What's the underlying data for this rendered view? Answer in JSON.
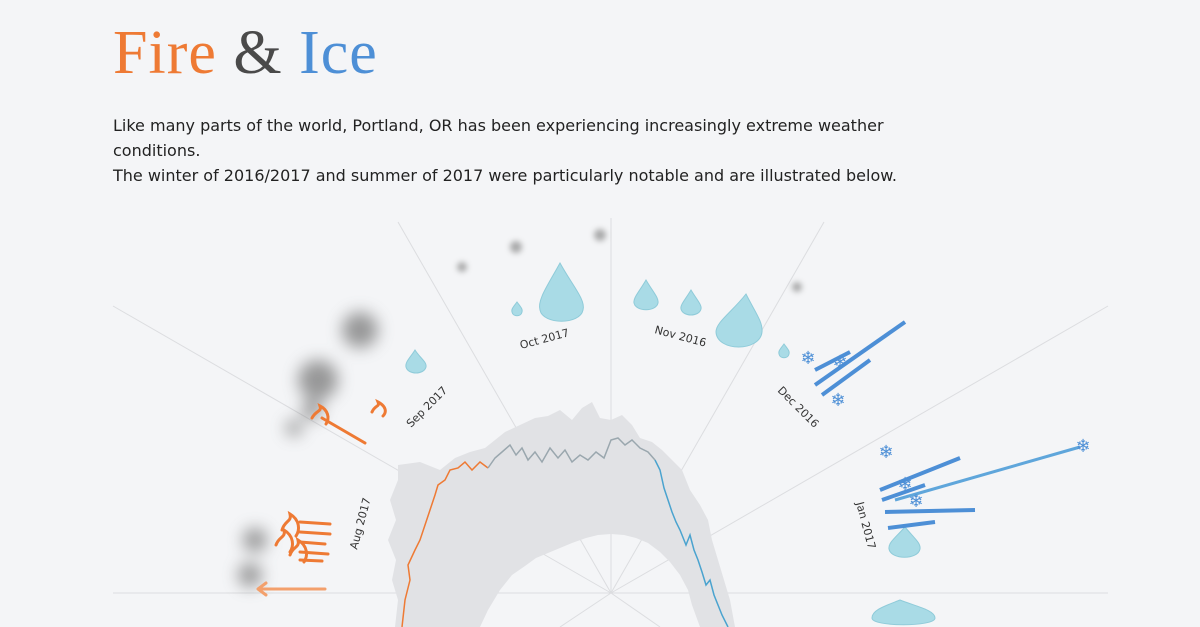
{
  "header": {
    "title_fire": "Fire",
    "title_amp": "&",
    "title_ice": "Ice"
  },
  "intro": {
    "line1": "Like many parts of the world, Portland, OR has been experiencing increasingly extreme weather conditions.",
    "line2": "The winter of 2016/2017 and summer of 2017 were particularly notable and are illustrated below."
  },
  "colors": {
    "fire": "#ee7a34",
    "ice": "#4d8fd6",
    "rain": "#8fd0de",
    "neutral": "#8a9aa5",
    "band": "#e2e3e6"
  },
  "chart_data": {
    "type": "radial-line",
    "month_labels": [
      "Aug 2017",
      "Sep 2017",
      "Oct 2017",
      "Nov 2016",
      "Dec 2016",
      "Jan 2017"
    ],
    "icons": [
      "flame-icon",
      "raindrop-icon",
      "snowflake-icon",
      "icicle-icon",
      "smoke-icon"
    ]
  }
}
